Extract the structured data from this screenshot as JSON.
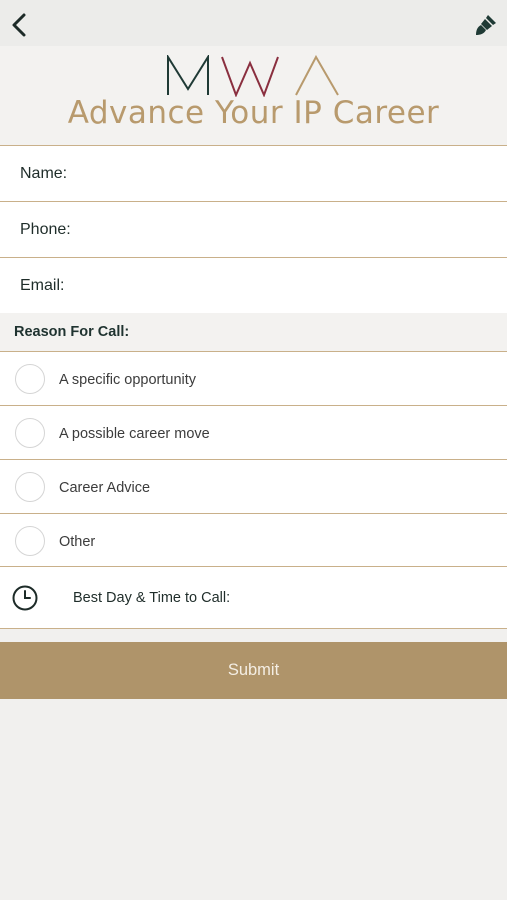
{
  "nav": {
    "back_icon": "chevron-left-icon",
    "theme_icon": "paintbrush-icon"
  },
  "header": {
    "logo_text": "MWA",
    "tagline": "Advance Your IP Career"
  },
  "form": {
    "fields": [
      {
        "label": "Name:",
        "value": ""
      },
      {
        "label": "Phone:",
        "value": ""
      },
      {
        "label": "Email:",
        "value": ""
      }
    ],
    "reason_heading": "Reason For Call:",
    "options": [
      {
        "label": "A specific opportunity",
        "selected": false
      },
      {
        "label": "A possible career move",
        "selected": false
      },
      {
        "label": "Career Advice",
        "selected": false
      },
      {
        "label": "Other",
        "selected": false
      }
    ],
    "datetime_label": "Best Day & Time to Call:",
    "datetime_icon": "clock-icon",
    "submit_label": "Submit"
  },
  "colors": {
    "accent": "#af946a",
    "logo_dark": "#1f3a35",
    "logo_wine": "#8a2f3f",
    "logo_gold": "#b89a6d"
  }
}
